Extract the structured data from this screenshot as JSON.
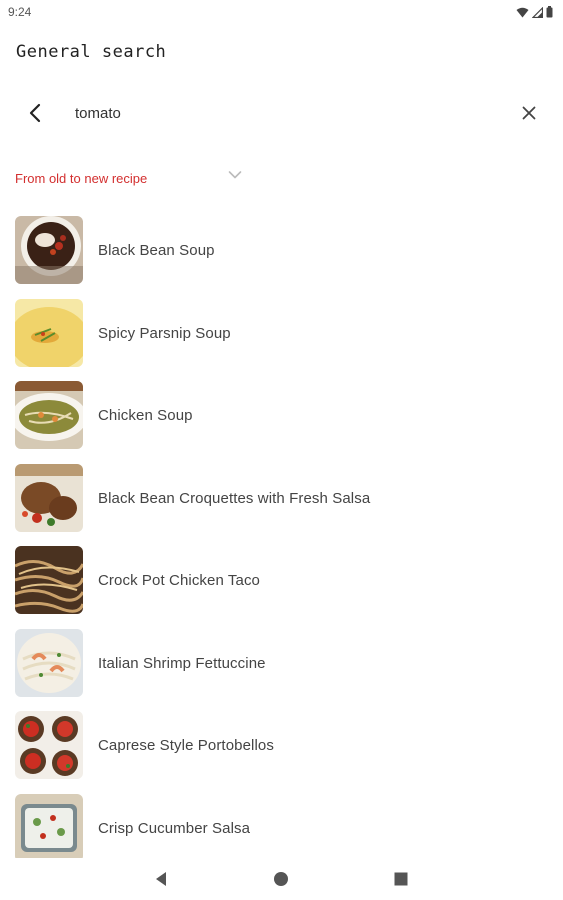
{
  "status_bar": {
    "time": "9:24",
    "icons": [
      "wifi-icon",
      "cell-signal-icon",
      "battery-icon"
    ]
  },
  "header": {
    "title": "General search"
  },
  "search": {
    "value": "tomato",
    "back_icon": "chevron-left-icon",
    "clear_icon": "close-icon"
  },
  "sort": {
    "selected": "From old to new recipe",
    "icon": "chevron-down-icon",
    "color": "#d32f2f"
  },
  "recipes": [
    {
      "title": "Black Bean Soup",
      "image": "black-bean-soup-photo"
    },
    {
      "title": "Spicy Parsnip Soup",
      "image": "parsnip-soup-photo"
    },
    {
      "title": "Chicken Soup",
      "image": "chicken-soup-photo"
    },
    {
      "title": "Black Bean Croquettes with Fresh Salsa",
      "image": "croquettes-photo"
    },
    {
      "title": "Crock Pot Chicken Taco",
      "image": "chicken-taco-photo"
    },
    {
      "title": "Italian Shrimp Fettuccine",
      "image": "shrimp-fettuccine-photo"
    },
    {
      "title": "Caprese Style Portobellos",
      "image": "portobellos-photo"
    },
    {
      "title": "Crisp Cucumber Salsa",
      "image": "cucumber-salsa-photo"
    }
  ],
  "nav_bar": {
    "icons": [
      "back-triangle-icon",
      "home-circle-icon",
      "recents-square-icon"
    ]
  }
}
